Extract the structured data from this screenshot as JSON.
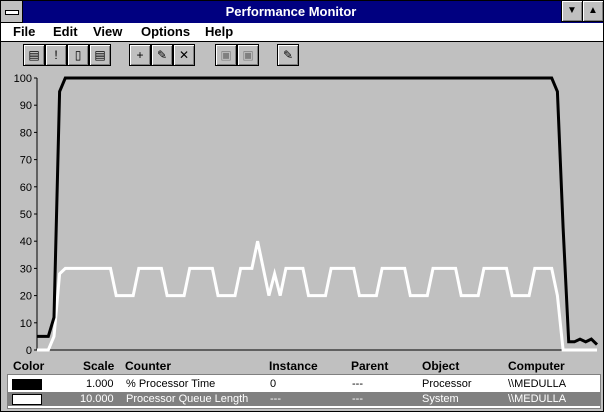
{
  "window": {
    "title": "Performance Monitor"
  },
  "menu": [
    "File",
    "Edit",
    "View",
    "Options",
    "Help"
  ],
  "toolbar": [
    {
      "name": "chart-view-button",
      "glyph": "▤",
      "enabled": true
    },
    {
      "name": "alert-view-button",
      "glyph": "!",
      "enabled": true
    },
    {
      "name": "log-view-button",
      "glyph": "▯",
      "enabled": true
    },
    {
      "name": "report-view-button",
      "glyph": "▤",
      "enabled": true
    },
    {
      "name": "add-counter-button",
      "glyph": "+",
      "enabled": true
    },
    {
      "name": "edit-counter-button",
      "glyph": "✎",
      "enabled": true
    },
    {
      "name": "delete-counter-button",
      "glyph": "✕",
      "enabled": true
    },
    {
      "name": "update-now-button",
      "glyph": "▣",
      "enabled": false
    },
    {
      "name": "bookmark-button",
      "glyph": "▣",
      "enabled": false
    },
    {
      "name": "options-button",
      "glyph": "✎",
      "enabled": true
    }
  ],
  "chart_data": {
    "type": "line",
    "ylim": [
      0,
      100
    ],
    "yticks": [
      0,
      10,
      20,
      30,
      40,
      50,
      60,
      70,
      80,
      90,
      100
    ],
    "grid": false,
    "background": "#c0c0c0",
    "x": [
      0,
      1,
      2,
      3,
      4,
      5,
      6,
      7,
      8,
      9,
      10,
      11,
      12,
      13,
      14,
      15,
      16,
      17,
      18,
      19,
      20,
      21,
      22,
      23,
      24,
      25,
      26,
      27,
      28,
      29,
      30,
      31,
      32,
      33,
      34,
      35,
      36,
      37,
      38,
      39,
      40,
      41,
      42,
      43,
      44,
      45,
      46,
      47,
      48,
      49,
      50,
      51,
      52,
      53,
      54,
      55,
      56,
      57,
      58,
      59,
      60,
      61,
      62,
      63,
      64,
      65,
      66,
      67,
      68,
      69,
      70,
      71,
      72,
      73,
      74,
      75,
      76,
      77,
      78,
      79,
      80,
      81,
      82,
      83,
      84,
      85,
      86,
      87,
      88,
      89,
      90,
      91,
      92,
      93,
      94,
      95,
      96,
      97,
      98,
      99
    ],
    "series": [
      {
        "color": "#000000",
        "values": [
          5,
          5,
          5,
          12,
          95,
          100,
          100,
          100,
          100,
          100,
          100,
          100,
          100,
          100,
          100,
          100,
          100,
          100,
          100,
          100,
          100,
          100,
          100,
          100,
          100,
          100,
          100,
          100,
          100,
          100,
          100,
          100,
          100,
          100,
          100,
          100,
          100,
          100,
          100,
          100,
          100,
          100,
          100,
          100,
          100,
          100,
          100,
          100,
          100,
          100,
          100,
          100,
          100,
          100,
          100,
          100,
          100,
          100,
          100,
          100,
          100,
          100,
          100,
          100,
          100,
          100,
          100,
          100,
          100,
          100,
          100,
          100,
          100,
          100,
          100,
          100,
          100,
          100,
          100,
          100,
          100,
          100,
          100,
          100,
          100,
          100,
          100,
          100,
          100,
          100,
          100,
          100,
          95,
          45,
          3,
          3,
          4,
          3,
          4,
          2
        ]
      },
      {
        "color": "#ffffff",
        "values": [
          0,
          0,
          0,
          5,
          28,
          30,
          30,
          30,
          30,
          30,
          30,
          30,
          30,
          30,
          20,
          20,
          20,
          20,
          30,
          30,
          30,
          30,
          30,
          20,
          20,
          20,
          20,
          30,
          30,
          30,
          30,
          30,
          20,
          20,
          20,
          20,
          30,
          30,
          30,
          40,
          30,
          20,
          28,
          20,
          30,
          30,
          30,
          30,
          20,
          20,
          20,
          20,
          30,
          30,
          30,
          30,
          30,
          20,
          20,
          20,
          20,
          30,
          30,
          30,
          30,
          30,
          20,
          20,
          20,
          20,
          30,
          30,
          30,
          30,
          30,
          20,
          20,
          20,
          20,
          30,
          30,
          30,
          30,
          30,
          20,
          20,
          20,
          20,
          30,
          30,
          30,
          30,
          20,
          0,
          0,
          0,
          0,
          0,
          0,
          0
        ]
      }
    ]
  },
  "legend": {
    "headers": {
      "color": "Color",
      "scale": "Scale",
      "counter": "Counter",
      "instance": "Instance",
      "parent": "Parent",
      "object": "Object",
      "computer": "Computer"
    },
    "rows": [
      {
        "scale": "1.000",
        "counter": "% Processor Time",
        "instance": "0",
        "parent": "---",
        "object": "Processor",
        "computer": "\\\\MEDULLA",
        "swatch": "#000000"
      },
      {
        "scale": "10.000",
        "counter": "Processor Queue Length",
        "instance": "---",
        "parent": "---",
        "object": "System",
        "computer": "\\\\MEDULLA",
        "swatch": "#ffffff"
      }
    ]
  }
}
